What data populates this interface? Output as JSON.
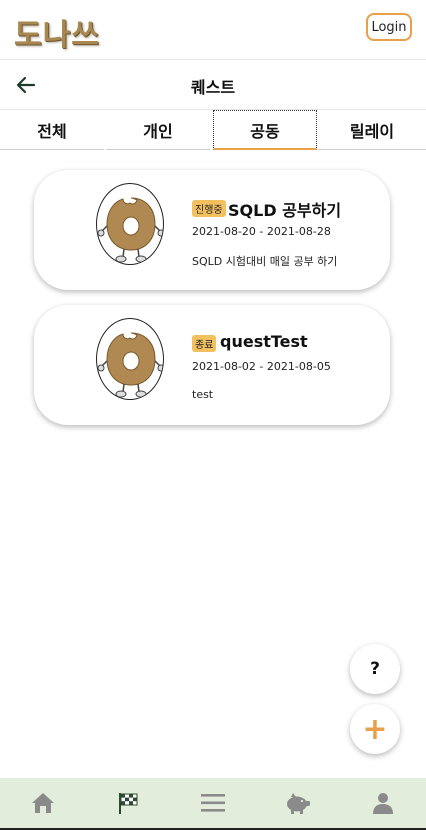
{
  "header": {
    "logo_text": "도나쓰",
    "login_label": "Login"
  },
  "subheader": {
    "title": "퀘스트",
    "back_icon": "arrow-left-icon"
  },
  "tabs": [
    {
      "label": "전체",
      "active": false
    },
    {
      "label": "개인",
      "active": false
    },
    {
      "label": "공동",
      "active": true
    },
    {
      "label": "릴레이",
      "active": false
    }
  ],
  "quests": [
    {
      "status": "진행중",
      "title": "SQLD 공부하기",
      "dates": "2021-08-20 - 2021-08-28",
      "description": "SQLD 시험대비 매일 공부 하기",
      "image": "donut-character-icon"
    },
    {
      "status": "종료",
      "title": "questTest",
      "dates": "2021-08-02 - 2021-08-05",
      "description": "test",
      "image": "donut-character-icon"
    }
  ],
  "fab": {
    "help_label": "?",
    "add_label": "+"
  },
  "bottom_nav": [
    {
      "icon": "home-icon",
      "active": false
    },
    {
      "icon": "checkered-flag-icon",
      "active": true
    },
    {
      "icon": "menu-icon",
      "active": false
    },
    {
      "icon": "piggy-bank-icon",
      "active": false
    },
    {
      "icon": "user-icon",
      "active": false
    }
  ],
  "colors": {
    "accent": "#e8a04a",
    "badge": "#f3c060",
    "nav_background": "#e3eddc",
    "nav_icon": "#8a8a8a",
    "nav_icon_active": "#2e4a30",
    "logo": "#a88751",
    "donut": "#b08852"
  }
}
